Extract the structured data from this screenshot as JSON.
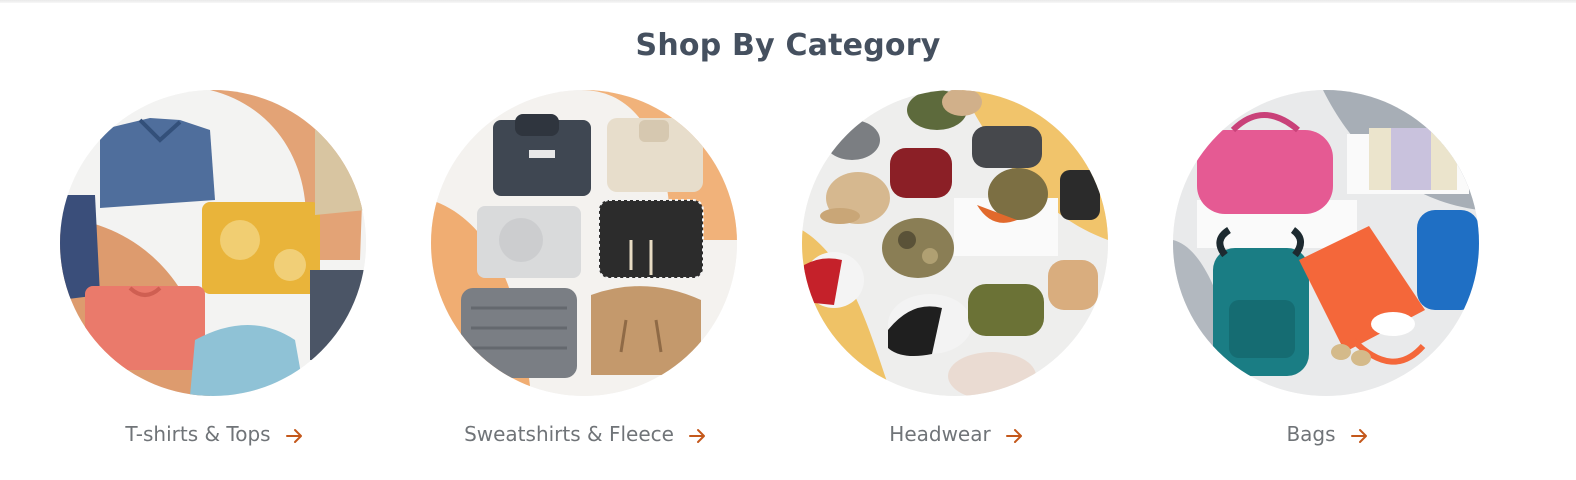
{
  "section": {
    "title": "Shop By Category"
  },
  "accent_color": "#c4581b",
  "categories": [
    {
      "label": "T-shirts & Tops",
      "image": "tshirts-tops-image",
      "icon": "arrow-right-icon"
    },
    {
      "label": "Sweatshirts & Fleece",
      "image": "sweatshirts-fleece-image",
      "icon": "arrow-right-icon"
    },
    {
      "label": "Headwear",
      "image": "headwear-image",
      "icon": "arrow-right-icon"
    },
    {
      "label": "Bags",
      "image": "bags-image",
      "icon": "arrow-right-icon"
    }
  ]
}
